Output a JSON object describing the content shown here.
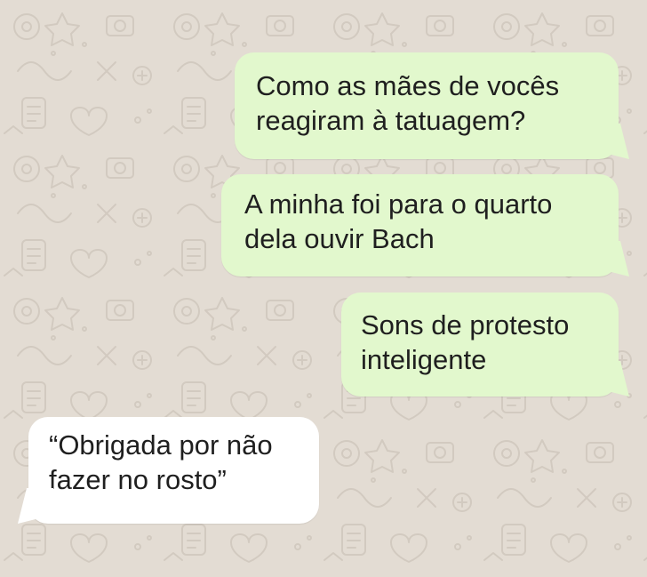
{
  "chat": {
    "colors": {
      "wallpaper": "#e3dcd3",
      "doodle": "#d2cac0",
      "outgoing_bubble": "#e2f8cd",
      "incoming_bubble": "#ffffff",
      "text": "#1f1f1f"
    },
    "messages": [
      {
        "direction": "outgoing",
        "lines": [
          "Como as mães de vocês",
          "reagiram à tatuagem?"
        ]
      },
      {
        "direction": "outgoing",
        "lines": [
          "A minha foi para o quarto",
          "dela ouvir Bach"
        ]
      },
      {
        "direction": "outgoing",
        "lines": [
          "Sons de protesto",
          "inteligente"
        ]
      },
      {
        "direction": "incoming",
        "lines": [
          "“Obrigada por não",
          "fazer no rosto”"
        ]
      }
    ]
  }
}
